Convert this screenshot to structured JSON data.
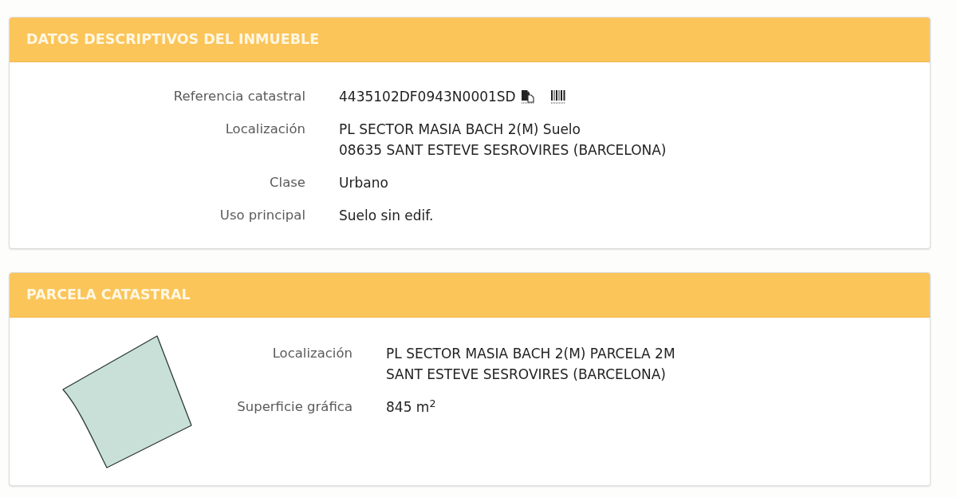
{
  "sections": [
    {
      "kind": "details",
      "title": "DATOS DESCRIPTIVOS DEL INMUEBLE",
      "fields": [
        {
          "kind": "reference",
          "label": "Referencia catastral",
          "lines": [
            "4435102DF0943N0001SD"
          ]
        },
        {
          "kind": "text",
          "label": "Localización",
          "lines": [
            "PL SECTOR MASIA BACH 2(M) Suelo",
            "08635 SANT ESTEVE SESROVIRES (BARCELONA)"
          ]
        },
        {
          "kind": "text",
          "label": "Clase",
          "lines": [
            "Urbano"
          ]
        },
        {
          "kind": "text",
          "label": "Uso principal",
          "lines": [
            "Suelo sin edif."
          ]
        }
      ]
    },
    {
      "kind": "parcel",
      "title": "PARCELA CATASTRAL",
      "fields": [
        {
          "kind": "text",
          "label": "Localización",
          "lines": [
            "PL SECTOR MASIA BACH 2(M) PARCELA 2M",
            "SANT ESTEVE SESROVIRES (BARCELONA)"
          ]
        },
        {
          "kind": "text",
          "label": "Superficie gráfica",
          "lines": [
            "845 m$^{2}$"
          ]
        }
      ]
    }
  ]
}
